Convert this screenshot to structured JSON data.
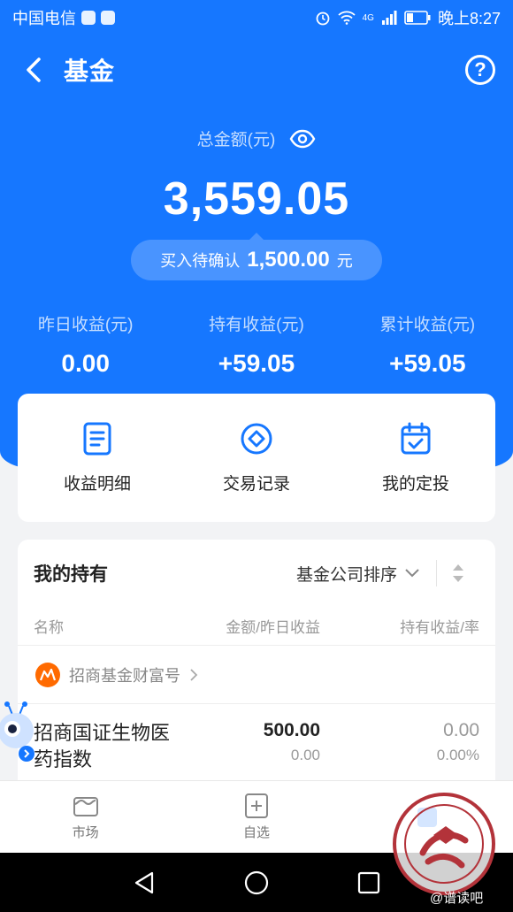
{
  "status_bar": {
    "carrier": "中国电信",
    "network": "4G",
    "time": "晚上8:27"
  },
  "nav": {
    "title": "基金",
    "help_symbol": "?"
  },
  "summary": {
    "total_label": "总金额(元)",
    "total_amount": "3,559.05",
    "pending_label": "买入待确认",
    "pending_amount": "1,500.00",
    "pending_unit": "元",
    "stats": [
      {
        "label": "昨日收益(元)",
        "value": "0.00"
      },
      {
        "label": "持有收益(元)",
        "value": "+59.05"
      },
      {
        "label": "累计收益(元)",
        "value": "+59.05"
      }
    ]
  },
  "quick_actions": [
    {
      "label": "收益明细",
      "icon": "document-icon"
    },
    {
      "label": "交易记录",
      "icon": "diamond-circle-icon"
    },
    {
      "label": "我的定投",
      "icon": "calendar-check-icon"
    }
  ],
  "holdings": {
    "title": "我的持有",
    "sort_label": "基金公司排序",
    "columns": [
      "名称",
      "金额/昨日收益",
      "持有收益/率"
    ],
    "company": "招商基金财富号",
    "funds": [
      {
        "name": "招商国证生物医药指数",
        "amount": "500.00",
        "yesterday": "0.00",
        "hold_return": "0.00",
        "hold_rate": "0.00%"
      }
    ]
  },
  "tabbar": [
    {
      "label": "市场",
      "icon": "market-icon"
    },
    {
      "label": "自选",
      "icon": "add-box-icon"
    }
  ],
  "colors": {
    "brand_blue": "#1677ff",
    "company_orange": "#ff6a00"
  },
  "watermark": {
    "text": "@谱读吧"
  }
}
